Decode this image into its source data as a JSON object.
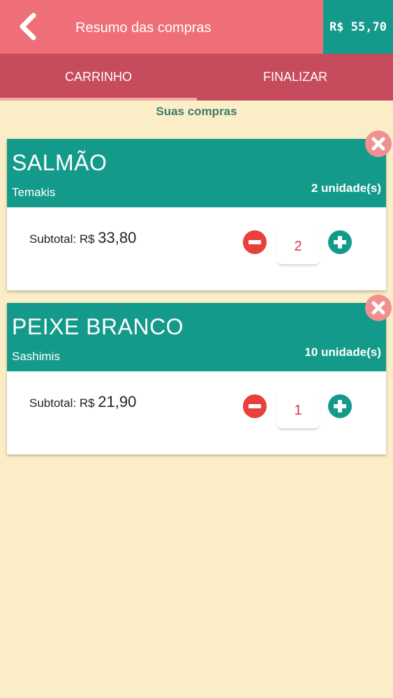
{
  "header": {
    "title": "Resumo das compras",
    "total": "R$ 55,70"
  },
  "tabs": [
    {
      "label": "CARRINHO",
      "active": true
    },
    {
      "label": "FINALIZAR",
      "active": false
    }
  ],
  "section_title": "Suas compras",
  "cart_items": [
    {
      "name": "SALMÃO",
      "category": "Temakis",
      "units": "2 unidade(s)",
      "subtotal_label": "Subtotal: R$",
      "subtotal_value": "33,80",
      "quantity": "2"
    },
    {
      "name": "PEIXE BRANCO",
      "category": "Sashimis",
      "units": "10 unidade(s)",
      "subtotal_label": "Subtotal: R$",
      "subtotal_value": "21,90",
      "quantity": "1"
    }
  ],
  "colors": {
    "header": "#ef6f78",
    "tabs": "#c64b5c",
    "accent": "#139a8a",
    "background": "#fbedc6",
    "minus": "#e8413b",
    "quantity_text": "#d3344a"
  },
  "icons": {
    "back": "chevron-left-icon",
    "remove": "close-circle-icon",
    "minus": "minus-circle-icon",
    "plus": "plus-circle-icon"
  }
}
